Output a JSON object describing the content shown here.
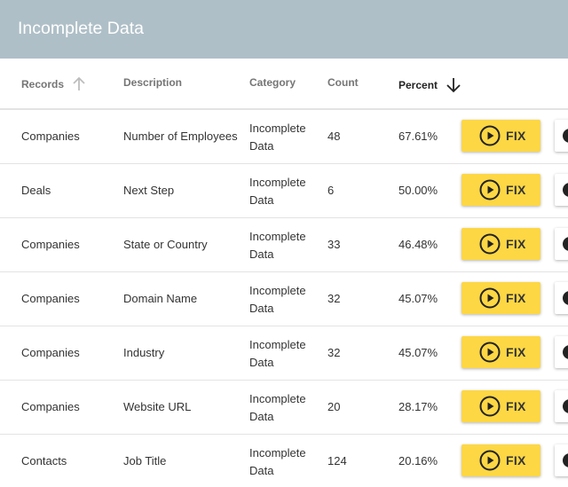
{
  "page": {
    "title": "Incomplete Data"
  },
  "columns": {
    "records": "Records",
    "description": "Description",
    "category": "Category",
    "count": "Count",
    "percent": "Percent"
  },
  "sort": {
    "records_icon": "arrow-up-icon",
    "percent_icon": "arrow-down-icon"
  },
  "colors": {
    "header_bg": "#afbfc7",
    "fix_button": "#fdd744"
  },
  "rows": [
    {
      "records": "Companies",
      "description": "Number of Employees",
      "category": "Incomplete Data",
      "count": "48",
      "percent": "67.61%",
      "action": "FIX"
    },
    {
      "records": "Deals",
      "description": "Next Step",
      "category": "Incomplete Data",
      "count": "6",
      "percent": "50.00%",
      "action": "FIX"
    },
    {
      "records": "Companies",
      "description": "State or Country",
      "category": "Incomplete Data",
      "count": "33",
      "percent": "46.48%",
      "action": "FIX"
    },
    {
      "records": "Companies",
      "description": "Domain Name",
      "category": "Incomplete Data",
      "count": "32",
      "percent": "45.07%",
      "action": "FIX"
    },
    {
      "records": "Companies",
      "description": "Industry",
      "category": "Incomplete Data",
      "count": "32",
      "percent": "45.07%",
      "action": "FIX"
    },
    {
      "records": "Companies",
      "description": "Website URL",
      "category": "Incomplete Data",
      "count": "20",
      "percent": "28.17%",
      "action": "FIX"
    },
    {
      "records": "Contacts",
      "description": "Job Title",
      "category": "Incomplete Data",
      "count": "124",
      "percent": "20.16%",
      "action": "FIX"
    }
  ]
}
